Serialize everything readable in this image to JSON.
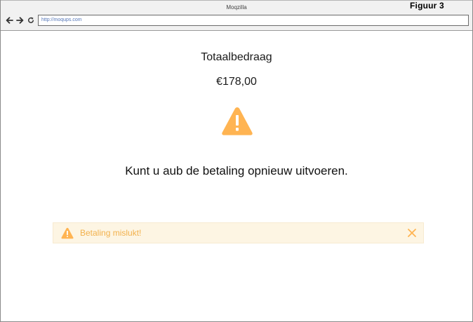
{
  "browser": {
    "window_title": "Moqzilla",
    "address_url": "http://moqups.com",
    "icons": {
      "back": "arrow-left-icon",
      "forward": "arrow-right-icon",
      "reload": "reload-icon"
    }
  },
  "figure_label": "Figuur 3",
  "payment": {
    "total_label": "Totaalbedraag",
    "amount": "€178,00",
    "warning_icon": "warning-triangle-icon",
    "retry_message": "Kunt u aub de betaling opnieuw uitvoeren."
  },
  "alert": {
    "text": "Betaling mislukt!",
    "icon": "warning-triangle-icon",
    "close_icon": "close-icon"
  },
  "colors": {
    "warning": "#ffb452",
    "alert_background": "#fdf5e3",
    "alert_text": "#f2b14c",
    "link": "#5677b8"
  }
}
